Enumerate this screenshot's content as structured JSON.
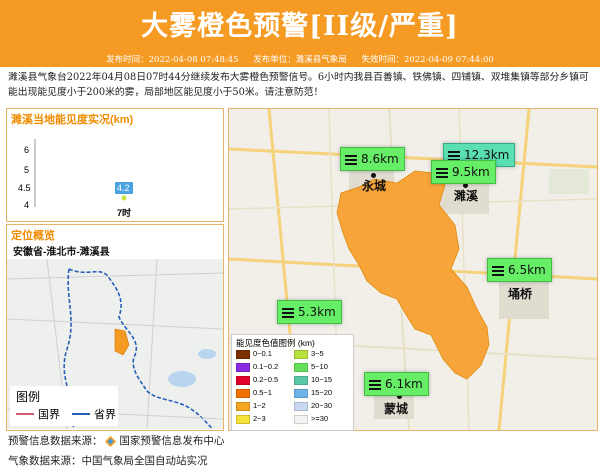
{
  "header": {
    "title": "大雾橙色预警[II级/严重]",
    "issue_time": "发布时间：2022-04-08 07:48:45",
    "issuer": "发布单位：濉溪县气象局",
    "expire_time": "失效时间：2022-04-09 07:44:00"
  },
  "description": "濉溪县气象台2022年04月08日07时44分继续发布大雾橙色预警信号。6小时内我县百善镇、铁佛镇、四铺镇、双堆集镇等部分乡镇可能出现能见度小于200米的雾，局部地区能见度小于50米。请注意防范！",
  "visibility_chart": {
    "title": "濉溪当地能见度实况(km)",
    "y_ticks": [
      "6",
      "5",
      "4.5",
      "4"
    ],
    "x_label": "7时",
    "point_label": "4.2"
  },
  "chart_data": {
    "type": "scatter",
    "title": "濉溪当地能见度实况(km)",
    "categories": [
      "7时"
    ],
    "values": [
      4.2
    ],
    "ylim": [
      4,
      6
    ],
    "grid": false
  },
  "location": {
    "title": "定位概览",
    "path": "安徽省-淮北市-濉溪县"
  },
  "mini_legend": {
    "title": "图例",
    "items": [
      "国界",
      "省界"
    ],
    "colors": [
      "#d0607a",
      "#2a5fb8"
    ]
  },
  "stations": [
    {
      "value": "8.6km"
    },
    {
      "value": "12.3km"
    },
    {
      "value": "9.5km"
    },
    {
      "value": "6.5km"
    },
    {
      "value": "5.3km"
    },
    {
      "value": "6.1km"
    }
  ],
  "cities": [
    "永城",
    "濉溪",
    "埇桥",
    "蒙城"
  ],
  "legend": {
    "title": "能见度色值图例 (km)",
    "items": [
      {
        "label": "0~0.1",
        "color": "#7b2e00"
      },
      {
        "label": "3~5",
        "color": "#b8e03a"
      },
      {
        "label": "0.1~0.2",
        "color": "#8a2be2"
      },
      {
        "label": "5~10",
        "color": "#66e05a"
      },
      {
        "label": "0.2~0.5",
        "color": "#e0002a"
      },
      {
        "label": "10~15",
        "color": "#5ac8a8"
      },
      {
        "label": "0.5~1",
        "color": "#f07000"
      },
      {
        "label": "15~20",
        "color": "#6fb4e8"
      },
      {
        "label": "1~2",
        "color": "#f5a623"
      },
      {
        "label": "20~30",
        "color": "#c8d8f0"
      },
      {
        "label": "2~3",
        "color": "#f5e23a"
      },
      {
        "label": ">=30",
        "color": "#f4f4f4"
      }
    ]
  },
  "footer": {
    "source1_prefix": "预警信息数据来源：",
    "source1_name": "国家预警信息发布中心",
    "source2": "气象数据来源：中国气象局全国自动站实况"
  },
  "colors": {
    "brand_orange": "#f59a23",
    "warning_area": "#f7a030",
    "station_green": "#66ee66"
  }
}
